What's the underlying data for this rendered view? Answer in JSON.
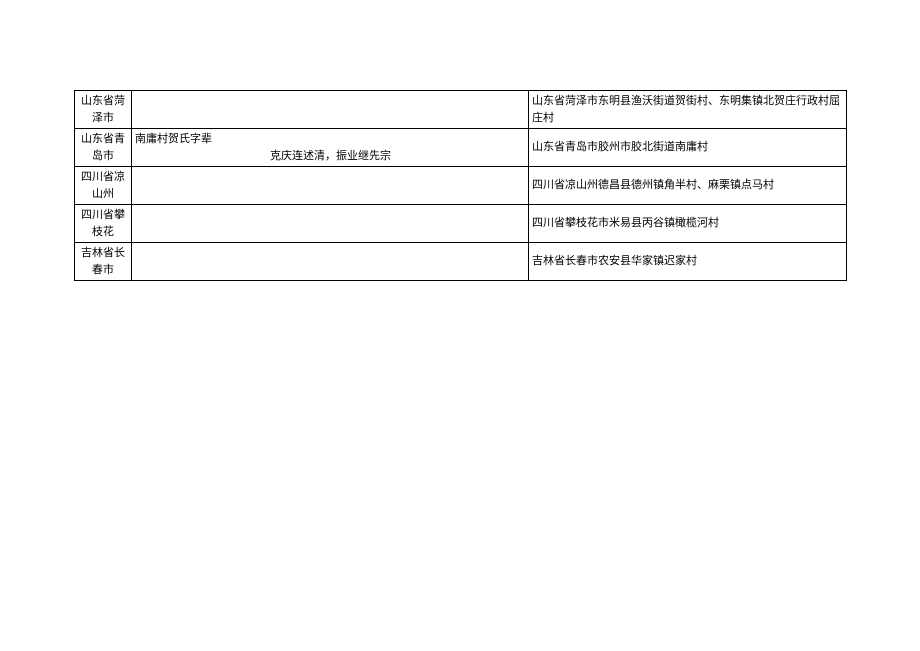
{
  "rows": [
    {
      "region": "山东省菏泽市",
      "middle_line1": "",
      "middle_line2": "",
      "location": "山东省菏泽市东明县渔沃街道贺街村、东明集镇北贺庄行政村屈庄村"
    },
    {
      "region": "山东省青岛市",
      "middle_line1": "南庸村贺氏字辈",
      "middle_line2": "克庆连述清，振业继先宗",
      "location": "山东省青岛市胶州市胶北街道南庸村"
    },
    {
      "region": "四川省凉山州",
      "middle_line1": "",
      "middle_line2": "",
      "location": "四川省凉山州德昌县德州镇角半村、麻栗镇点马村"
    },
    {
      "region": "四川省攀枝花",
      "middle_line1": "",
      "middle_line2": "",
      "location": "四川省攀枝花市米易县丙谷镇橄榄河村"
    },
    {
      "region": "吉林省长春市",
      "middle_line1": "",
      "middle_line2": "",
      "location": "吉林省长春市农安县华家镇迟家村"
    }
  ]
}
